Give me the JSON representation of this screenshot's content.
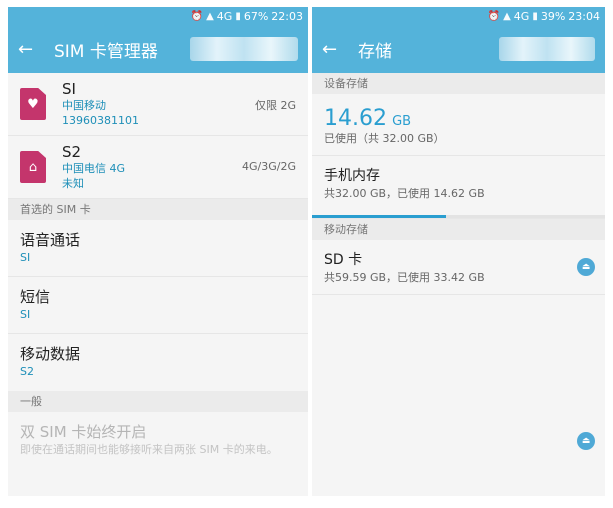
{
  "left": {
    "status": {
      "percent": "67%",
      "time": "22:03",
      "network": "4G"
    },
    "title": "SIM 卡管理器",
    "sims": [
      {
        "name": "SI",
        "carrier": "中国移动",
        "number": "13960381101",
        "mode": "仅限 2G",
        "icon": "heart-icon"
      },
      {
        "name": "S2",
        "carrier": "中国电信 4G",
        "number": "未知",
        "mode": "4G/3G/2G",
        "icon": "home-icon"
      }
    ],
    "preferred_header": "首选的 SIM 卡",
    "preferred": [
      {
        "title": "语音通话",
        "value": "SI"
      },
      {
        "title": "短信",
        "value": "SI"
      },
      {
        "title": "移动数据",
        "value": "S2"
      }
    ],
    "general_header": "一般",
    "dual_sim": {
      "title": "双 SIM 卡始终开启",
      "desc": "即使在通话期间也能够接听来自两张 SIM 卡的来电。"
    }
  },
  "right": {
    "status": {
      "percent": "39%",
      "time": "23:04",
      "network": "4G"
    },
    "title": "存储",
    "device_header": "设备存储",
    "used_value": "14.62",
    "used_unit": "GB",
    "used_label": "已使用（共 32.00 GB）",
    "internal": {
      "title": "手机内存",
      "detail": "共32.00 GB，已使用 14.62 GB",
      "fraction": 0.457
    },
    "mobile_header": "移动存储",
    "sd": {
      "title": "SD 卡",
      "detail": "共59.59 GB，已使用 33.42 GB"
    }
  },
  "colors": {
    "accent": "#54b3da",
    "link": "#1e8fb8",
    "sim": "#c4356c"
  }
}
